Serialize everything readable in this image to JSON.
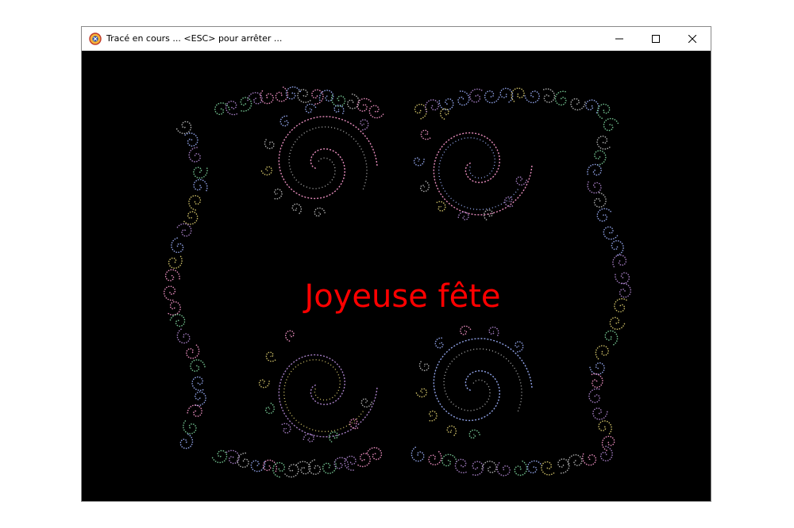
{
  "window": {
    "title": "Tracé en cours ... <ESC> pour arrêter ...",
    "icon": "app-logo-icon",
    "controls": {
      "minimize_icon": "minimize-icon",
      "maximize_icon": "maximize-icon",
      "close_icon": "close-icon"
    }
  },
  "canvas": {
    "background_color": "#000000",
    "greeting_text": "Joyeuse fête",
    "greeting_color": "#ff0000",
    "fractal_colors": [
      "#b58ad6",
      "#7fd7a0",
      "#e0d070",
      "#c0c0c0",
      "#9fb3ff",
      "#ff9ad0"
    ]
  }
}
